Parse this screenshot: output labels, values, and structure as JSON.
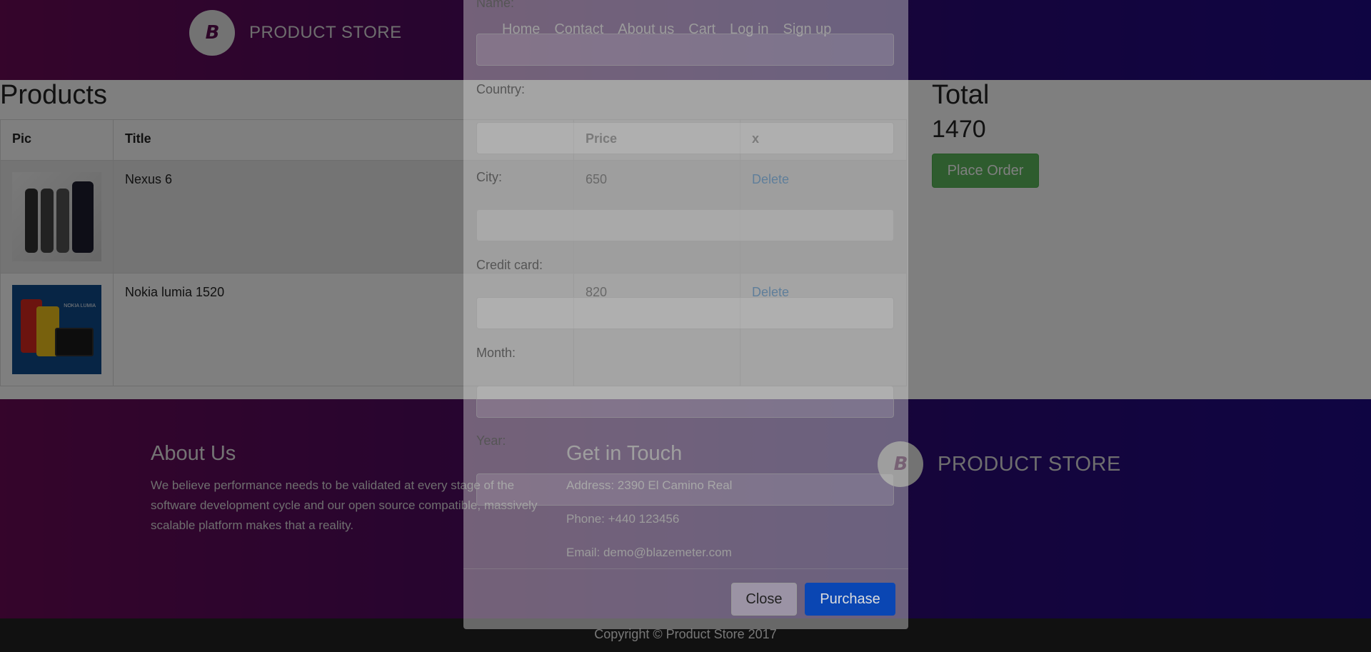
{
  "navbar": {
    "brand_text": "PRODUCT STORE",
    "logo_glyph": "B",
    "links": [
      "Home",
      "Contact",
      "About us",
      "Cart",
      "Log in",
      "Sign up"
    ]
  },
  "products": {
    "title": "Products",
    "columns": [
      "Pic",
      "Title",
      "Price",
      "x"
    ],
    "rows": [
      {
        "title": "Nexus 6",
        "price": "650",
        "action": "Delete",
        "image_icon": "phone-image"
      },
      {
        "title": "Nokia lumia 1520",
        "price": "820",
        "action": "Delete",
        "image_icon": "phone-image",
        "image_text": "NOKIA LUMIA"
      }
    ]
  },
  "total": {
    "title": "Total",
    "value": "1470",
    "place_order_label": "Place Order"
  },
  "footer": {
    "about_title": "About Us",
    "about_text": "We believe performance needs to be validated at every stage of the software development cycle and our open source compatible, massively scalable platform makes that a reality.",
    "touch_title": "Get in Touch",
    "address": "Address: 2390 El Camino Real",
    "phone": "Phone: +440 123456",
    "email": "Email: demo@blazemeter.com",
    "brand_text": "PRODUCT STORE",
    "logo_glyph": "B",
    "copyright": "Copyright © Product Store 2017"
  },
  "modal": {
    "labels": {
      "name": "Name:",
      "country": "Country:",
      "city": "City:",
      "card": "Credit card:",
      "month": "Month:",
      "year": "Year:"
    },
    "close_label": "Close",
    "purchase_label": "Purchase"
  },
  "colors": {
    "place_order": "#5cb85c",
    "purchase": "#0a46b3",
    "link": "#0275d8"
  }
}
